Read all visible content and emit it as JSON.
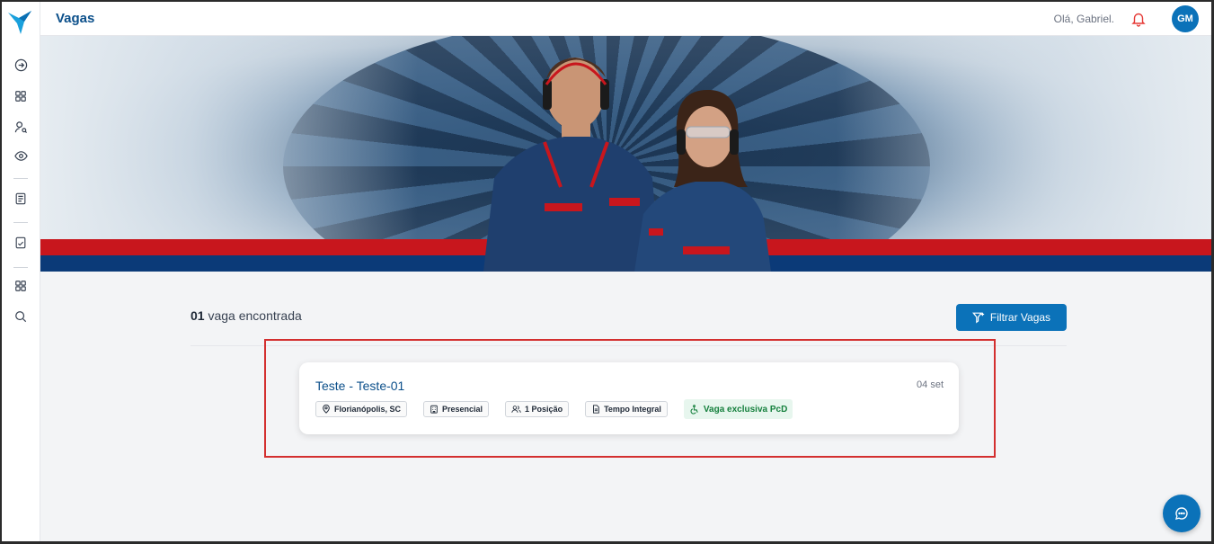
{
  "topbar": {
    "title": "Vagas",
    "greeting": "Olá, Gabriel.",
    "avatar_initials": "GM"
  },
  "sidebar": {
    "items": [
      {
        "icon": "arrow-circle-right-icon"
      },
      {
        "icon": "grid-icon"
      },
      {
        "icon": "user-search-icon"
      },
      {
        "icon": "eye-icon"
      },
      {
        "icon": "document-list-icon"
      },
      {
        "icon": "document-check-icon"
      },
      {
        "icon": "grid-icon"
      },
      {
        "icon": "search-icon"
      }
    ]
  },
  "results": {
    "count": "01",
    "count_label": "vaga encontrada",
    "filter_button": "Filtrar Vagas"
  },
  "job": {
    "title": "Teste - Teste-01",
    "date": "04 set",
    "location": "Florianópolis, SC",
    "mode": "Presencial",
    "positions": "1 Posição",
    "schedule": "Tempo Integral",
    "pcd": "Vaga exclusiva PcD"
  },
  "colors": {
    "brand_blue": "#0b72b9",
    "title_blue": "#0b4f8a",
    "highlight_red": "#d32f2f",
    "pcd_green": "#15803d",
    "stripe_red": "#c8161d",
    "stripe_blue": "#0b3a78"
  }
}
